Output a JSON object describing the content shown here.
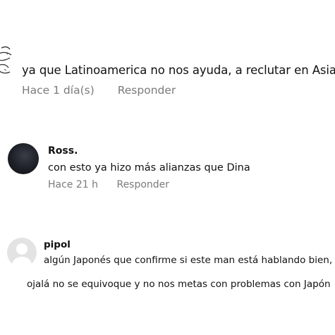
{
  "comments": [
    {
      "avatar_icon": "sketch-face-icon",
      "text": "ya que Latinoamerica no nos ayuda, a reclutar en Asia",
      "time": "Hace 1 día(s)",
      "reply_label": "Responder"
    },
    {
      "avatar_icon": "dark-avatar-icon",
      "author": "Ross.",
      "text": "con esto ya hizo más alianzas que Dina",
      "time": "Hace 21 h",
      "reply_label": "Responder"
    },
    {
      "avatar_icon": "default-user-icon",
      "author": "pipol",
      "text": "algún Japonés que confirme si este man está hablando bien,",
      "text_continued": "ojalá no se equivoque y no nos metas con problemas con Japón"
    }
  ],
  "colors": {
    "text": "#111111",
    "meta": "#7b7b7b",
    "default_avatar_bg": "#e3e3e3",
    "default_avatar_fg": "#ffffff"
  }
}
